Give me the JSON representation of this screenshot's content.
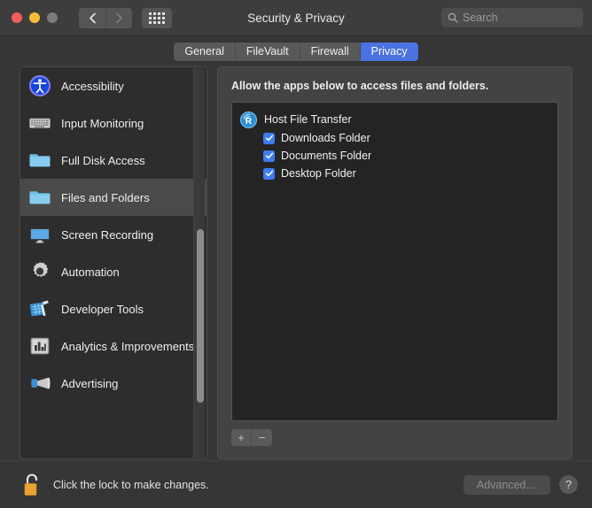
{
  "window": {
    "title": "Security & Privacy",
    "traffic_lights": [
      "close-button",
      "minimize-button",
      "zoom-button"
    ],
    "back_label": "Back",
    "forward_label": "Forward",
    "grid_label": "Show All"
  },
  "search": {
    "placeholder": "Search",
    "value": "",
    "icon": "search-icon"
  },
  "tabs": [
    {
      "label": "General",
      "active": false
    },
    {
      "label": "FileVault",
      "active": false
    },
    {
      "label": "Firewall",
      "active": false
    },
    {
      "label": "Privacy",
      "active": true
    }
  ],
  "sidebar": {
    "items": [
      {
        "label": "Accessibility",
        "icon": "accessibility-icon",
        "selected": false
      },
      {
        "label": "Input Monitoring",
        "icon": "keyboard-icon",
        "selected": false
      },
      {
        "label": "Full Disk Access",
        "icon": "folder-icon",
        "selected": false
      },
      {
        "label": "Files and Folders",
        "icon": "folder-icon",
        "selected": true
      },
      {
        "label": "Screen Recording",
        "icon": "display-icon",
        "selected": false
      },
      {
        "label": "Automation",
        "icon": "gear-icon",
        "selected": false
      },
      {
        "label": "Developer Tools",
        "icon": "hammer-blueprint-icon",
        "selected": false
      },
      {
        "label": "Analytics & Improvements",
        "icon": "bar-chart-icon",
        "selected": false
      },
      {
        "label": "Advertising",
        "icon": "megaphone-icon",
        "selected": false
      }
    ],
    "scrollbar": "vertical-scrollbar"
  },
  "panel": {
    "description": "Allow the apps below to access files and folders.",
    "apps": [
      {
        "name": "Host File Transfer",
        "icon": "host-file-transfer-icon",
        "permissions": [
          {
            "label": "Downloads Folder",
            "checked": true
          },
          {
            "label": "Documents Folder",
            "checked": true
          },
          {
            "label": "Desktop Folder",
            "checked": true
          }
        ]
      }
    ],
    "add_label": "+",
    "remove_label": "−"
  },
  "footer": {
    "lock_icon": "unlocked-padlock-icon",
    "lock_text": "Click the lock to make changes.",
    "advanced_label": "Advanced…",
    "advanced_disabled": true,
    "help_label": "?"
  },
  "colors": {
    "accent": "#4a72e0",
    "checkbox": "#3f7bf0",
    "window_bg": "#363636",
    "titlebar_bg": "#3d3d3d",
    "panel_bg": "#434343",
    "list_bg": "#242424",
    "sidebar_bg": "#2d2d2d",
    "selected_row": "#4a4a4a",
    "lock_gold": "#f0a838",
    "close_red": "#f05e57",
    "min_yellow": "#f6bd3b",
    "zoom_gray": "#7b7b7b"
  }
}
